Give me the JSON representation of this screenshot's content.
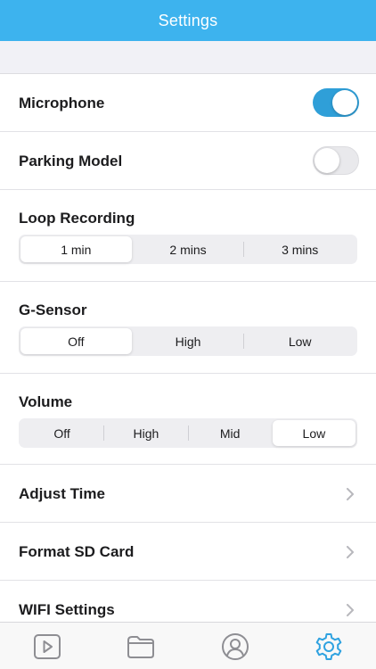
{
  "header": {
    "title": "Settings"
  },
  "settings": {
    "microphone": {
      "label": "Microphone",
      "enabled": true
    },
    "parking": {
      "label": "Parking Model",
      "enabled": false
    },
    "loop": {
      "label": "Loop Recording",
      "options": [
        "1 min",
        "2 mins",
        "3 mins"
      ],
      "selected": "1 min"
    },
    "gsensor": {
      "label": "G-Sensor",
      "options": [
        "Off",
        "High",
        "Low"
      ],
      "selected": "Off"
    },
    "volume": {
      "label": "Volume",
      "options": [
        "Off",
        "High",
        "Mid",
        "Low"
      ],
      "selected": "Low"
    },
    "adjust_time": {
      "label": "Adjust Time"
    },
    "format_sd": {
      "label": "Format SD Card"
    },
    "wifi": {
      "label": "WIFI Settings"
    }
  },
  "tabbar": {
    "tabs": [
      {
        "icon": "play-icon",
        "active": false
      },
      {
        "icon": "folder-icon",
        "active": false
      },
      {
        "icon": "user-icon",
        "active": false
      },
      {
        "icon": "gear-icon",
        "active": true
      }
    ]
  },
  "colors": {
    "accent": "#3db3ee",
    "toggle_on": "#2f9fd8",
    "inactive_icon": "#8e8e93"
  }
}
